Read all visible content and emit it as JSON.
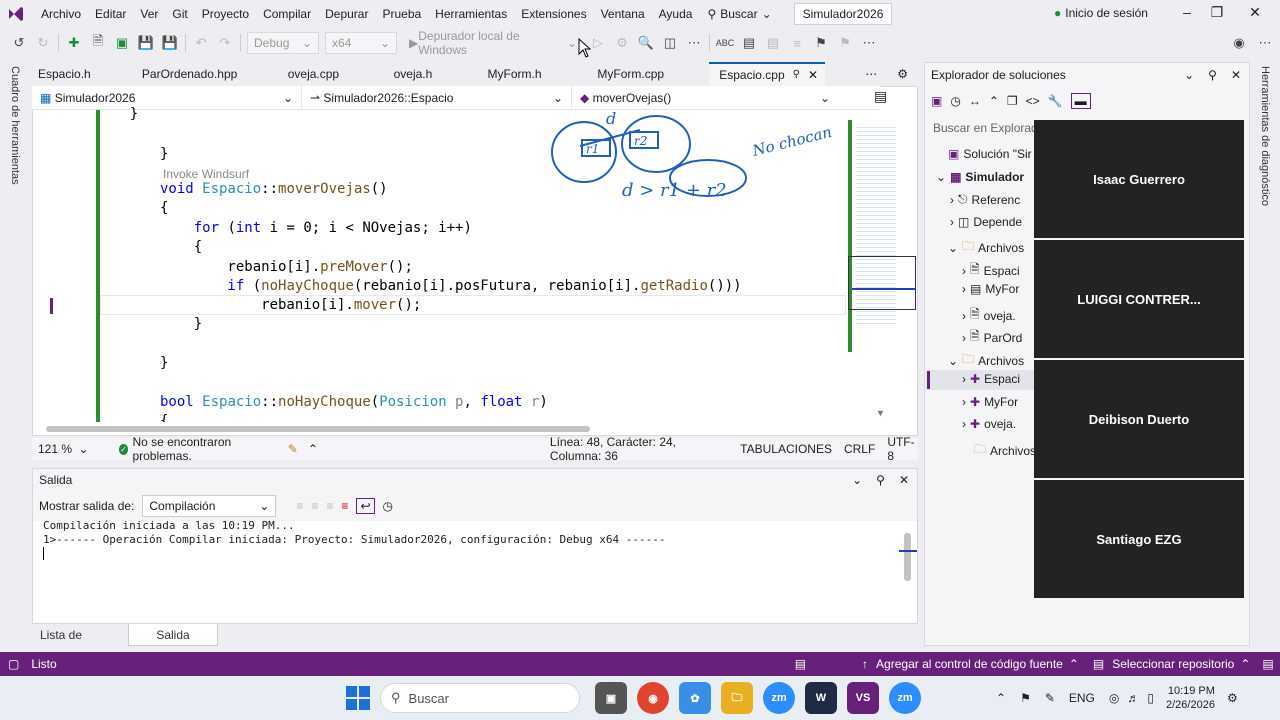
{
  "menubar": {
    "items": [
      "Archivo",
      "Editar",
      "Ver",
      "Git",
      "Proyecto",
      "Compilar",
      "Depurar",
      "Prueba",
      "Herramientas",
      "Extensiones",
      "Ventana",
      "Ayuda"
    ],
    "search_label": "Buscar",
    "project_name": "Simulador2026",
    "signin_label": "Inicio de sesión"
  },
  "toolbar": {
    "config": "Debug",
    "platform": "x64",
    "debugger": "Depurador local de Windows"
  },
  "left_strip_label": "Cuadro de herramientas",
  "right_strip_label": "Herramientas de diagnóstico",
  "tabs": [
    "Espacio.h",
    "ParOrdenado.hpp",
    "oveja.cpp",
    "oveja.h",
    "MyForm.h",
    "MyForm.cpp",
    "Espacio.cpp"
  ],
  "navbar": {
    "project": "Simulador2026",
    "scope": "Simulador2026::Espacio",
    "member": "moverOvejas()"
  },
  "code": {
    "hint": "Invoke Windsurf",
    "l1": "    }",
    "l2": "}",
    "l4a": "void ",
    "l4b": "Espacio",
    "l4c": "::",
    "l4d": "moverOvejas",
    "l4e": "()",
    "l5": "{",
    "l6a": "    for",
    "l6b": " (",
    "l6c": "int",
    "l6d": " i = 0; i < NOvejas; i++)",
    "l7": "    {",
    "l8a": "        rebanio[i].",
    "l8b": "preMover",
    "l8c": "();",
    "l9a": "        if",
    "l9b": " (",
    "l9c": "noHayChoque",
    "l9d": "(rebanio[i].posFutura, rebanio[i].",
    "l9e": "getRadio",
    "l9f": "()))",
    "l10a": "            rebanio[i].",
    "l10b": "mover",
    "l10c": "();",
    "l11": "    }",
    "l13": "}",
    "l15a": "bool ",
    "l15b": "Espacio",
    "l15c": "::",
    "l15d": "noHayChoque",
    "l15e": "(",
    "l15f": "Posicion",
    "l15g": " p",
    "l15h": ", ",
    "l15i": "float",
    "l15j": " r",
    "l15k": ")",
    "l16": "{"
  },
  "annotations": {
    "d_top": "d",
    "r1": "r1",
    "r2": "r2",
    "inequality": "d > r1 + r2",
    "note": "No chocan"
  },
  "editor_status": {
    "zoom": "121 %",
    "problems": "No se encontraron problemas.",
    "position": "Línea: 48, Carácter: 24, Columna: 36",
    "indent": "TABULACIONES",
    "eol": "CRLF",
    "encoding": "UTF-8"
  },
  "output": {
    "title": "Salida",
    "show_label": "Mostrar salida de:",
    "source": "Compilación",
    "line1": "Compilación iniciada a las 10:19 PM...",
    "line2": "1>------ Operación Compilar iniciada: Proyecto: Simulador2026, configuración: Debug x64 ------"
  },
  "bottom_tabs": [
    "Lista de errores...",
    "Salida"
  ],
  "solution": {
    "title": "Explorador de soluciones",
    "search_placeholder": "Buscar en Explorador",
    "items": [
      "Solución \"Sir",
      "Simulador",
      "Referenc",
      "Depende",
      "Archivos",
      "Espaci",
      "MyFor",
      "oveja.",
      "ParOrd",
      "Archivos",
      "Espaci",
      "MyFor",
      "oveja.",
      "Archivos"
    ]
  },
  "participants": [
    "Isaac Guerrero",
    "LUIGGI  CONTRER...",
    "Deibison Duerto",
    "Santiago EZG"
  ],
  "vs_status": {
    "ready": "Listo",
    "git_add": "Agregar al control de código fuente",
    "repo": "Seleccionar repositorio"
  },
  "taskbar": {
    "search": "Buscar",
    "lang": "ENG",
    "time": "10:19 PM",
    "date": "2/26/2026"
  },
  "colors": {
    "accent": "#68217a",
    "keyword": "#0000ff",
    "type": "#2b91af",
    "function": "#74531f",
    "ink": "#1f5fbf"
  }
}
